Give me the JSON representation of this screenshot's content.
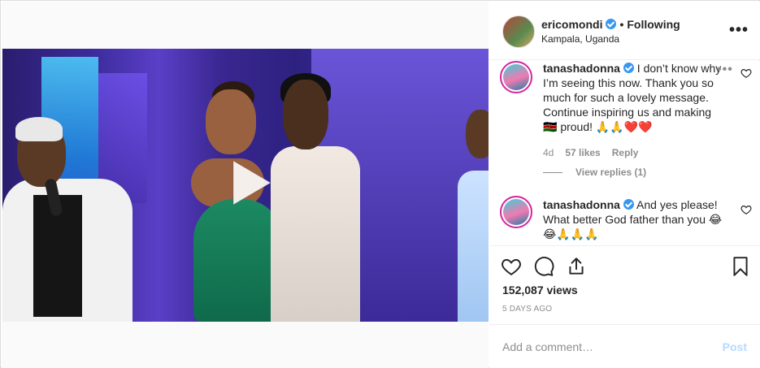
{
  "header": {
    "username": "ericomondi",
    "separator": "•",
    "follow_label": "Following",
    "location": "Kampala, Uganda",
    "more_label": "•••"
  },
  "comments": [
    {
      "username": "tanashadonna",
      "text": "I don’t know why I’m seeing this now. Thank you so much for such a lovely message. Continue inspiring us and making 🇰🇪 proud! 🙏🙏❤️❤️",
      "age": "4d",
      "likes": "57 likes",
      "reply_label": "Reply",
      "view_replies": "View replies (1)",
      "more_label": "•••"
    },
    {
      "username": "tanashadonna",
      "text": "And yes please! What better God father than you 😂😂🙏🙏🙏"
    }
  ],
  "actions": {
    "views": "152,087 views",
    "date": "5 DAYS AGO"
  },
  "add_comment": {
    "placeholder": "Add a comment…",
    "post_label": "Post"
  },
  "icons": {
    "like": "heart-icon",
    "comment": "comment-icon",
    "share": "share-icon",
    "save": "bookmark-icon",
    "play": "play-icon",
    "verified": "verified-badge-icon"
  },
  "colors": {
    "verified_blue": "#3897f0",
    "post_disabled": "#b3dbff",
    "secondary_text": "#8e8e8e"
  }
}
